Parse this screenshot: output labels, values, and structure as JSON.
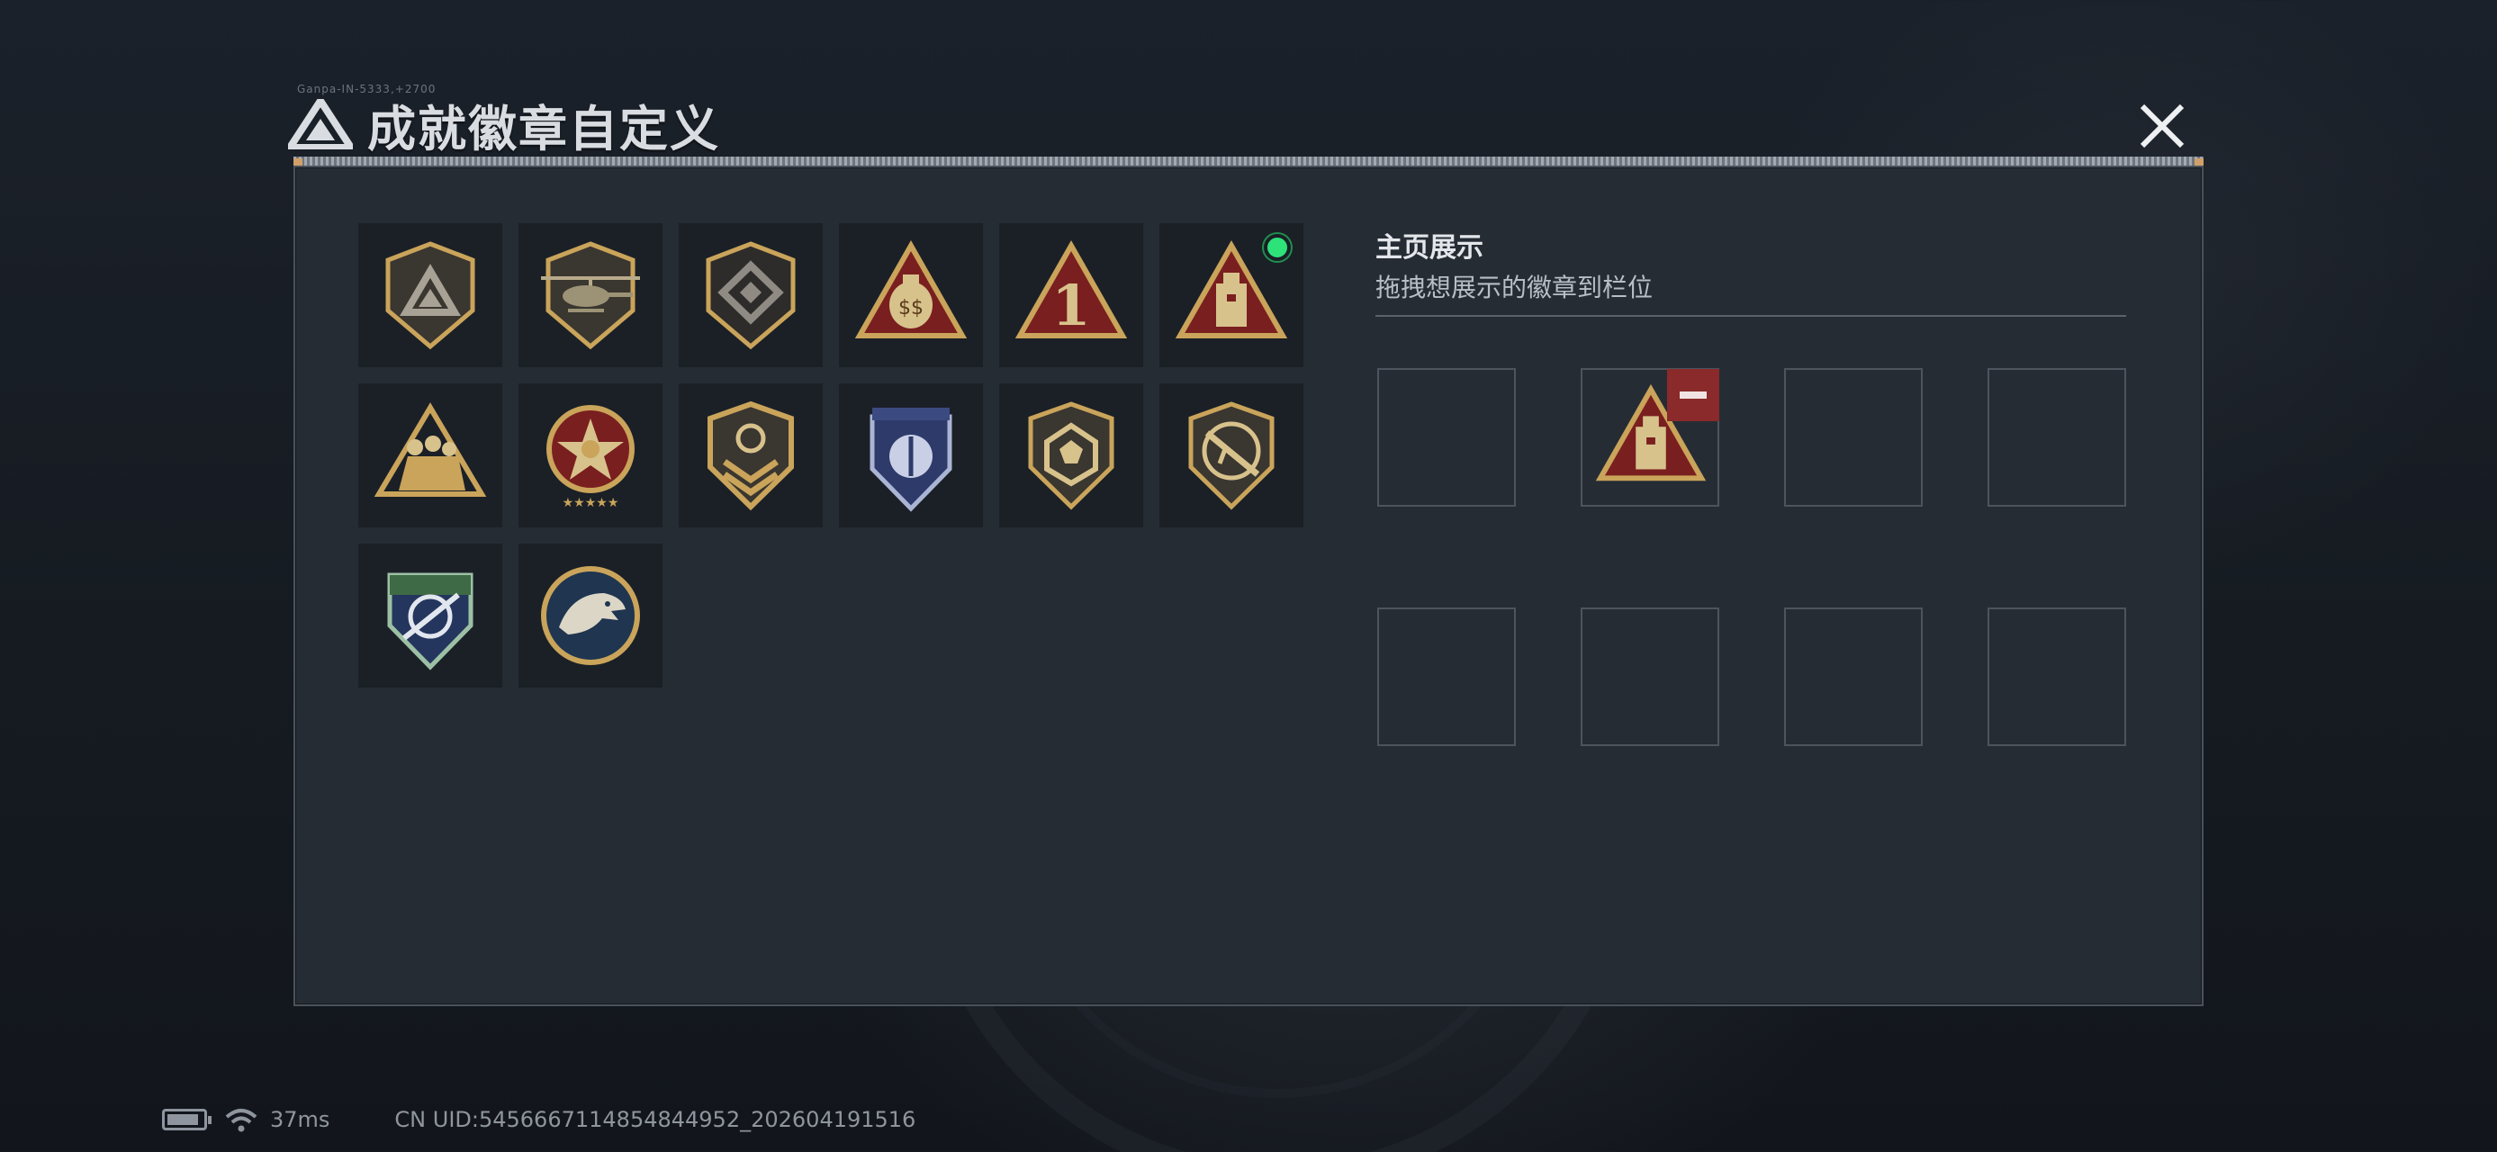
{
  "header": {
    "title": "成就徽章自定义",
    "tiny_text": "Ganpa-IN-5333,+2700"
  },
  "right_panel": {
    "section_title": "主页展示",
    "section_subtitle": "拖拽想展示的徽章到栏位"
  },
  "badges": [
    {
      "icon": "shield-triangle-badge-icon"
    },
    {
      "icon": "helicopter-badge-icon"
    },
    {
      "icon": "diamond-emblem-badge-icon"
    },
    {
      "icon": "money-bag-ss-badge-icon"
    },
    {
      "icon": "number-one-badge-icon"
    },
    {
      "icon": "tower-badge-icon",
      "selected": true
    },
    {
      "icon": "soldiers-badge-icon"
    },
    {
      "icon": "star-medal-badge-icon"
    },
    {
      "icon": "chevron-shield-badge-icon"
    },
    {
      "icon": "blue-star-shield-badge-icon"
    },
    {
      "icon": "dice-badge-icon"
    },
    {
      "icon": "rifle-badge-icon"
    },
    {
      "icon": "crosshair-green-badge-icon"
    },
    {
      "icon": "eagle-badge-icon"
    }
  ],
  "display_slots": [
    {
      "filled": false
    },
    {
      "filled": true,
      "icon": "tower-badge-icon"
    },
    {
      "filled": false
    },
    {
      "filled": false
    },
    {
      "filled": false
    },
    {
      "filled": false
    },
    {
      "filled": false
    },
    {
      "filled": false
    }
  ],
  "status_bar": {
    "ping": "37ms",
    "uid": "CN UID:5456667114854844952_202604191516"
  },
  "colors": {
    "panel": "#262c34",
    "tile": "#1b2027",
    "gold": "#c9a45a",
    "selected_dot": "#2ee27a",
    "remove": "#8a2a2a"
  }
}
